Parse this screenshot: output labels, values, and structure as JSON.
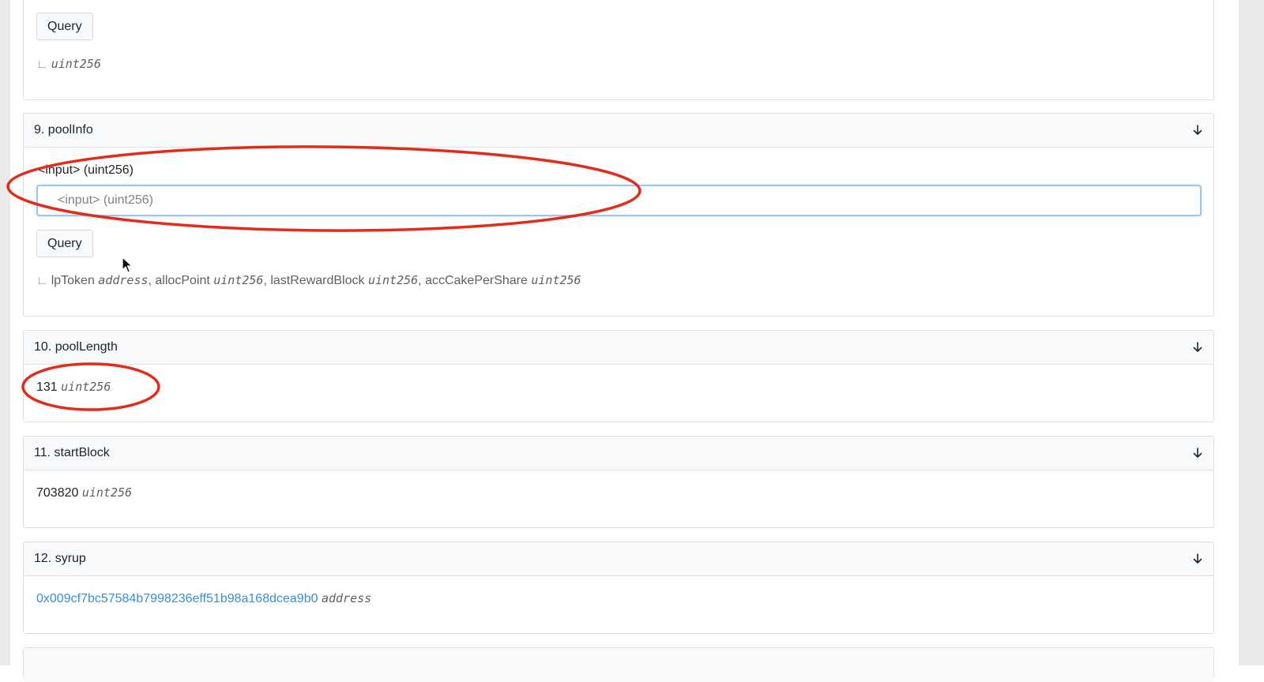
{
  "card8": {
    "query_label": "Query",
    "output_type": "uint256"
  },
  "card9": {
    "title": "9. poolInfo",
    "input_label": "<input> (uint256)",
    "input_placeholder": "<input> (uint256)",
    "query_label": "Query",
    "outputs": [
      {
        "name": "lpToken",
        "type": "address"
      },
      {
        "name": "allocPoint",
        "type": "uint256"
      },
      {
        "name": "lastRewardBlock",
        "type": "uint256"
      },
      {
        "name": "accCakePerShare",
        "type": "uint256"
      }
    ],
    "sep": ", "
  },
  "card10": {
    "title": "10. poolLength",
    "value": "131",
    "type": "uint256"
  },
  "card11": {
    "title": "11. startBlock",
    "value": "703820",
    "type": "uint256"
  },
  "card12": {
    "title": "12. syrup",
    "value": "0x009cf7bc57584b7998236eff51b98a168dcea9b0",
    "type": "address"
  },
  "colors": {
    "annotation_red": "#e32b17",
    "link_blue": "#3a8ed2",
    "focus_border": "#9ec5ec"
  },
  "icons": {
    "collapse": "arrow-down-icon",
    "corner": "corner-branch-icon",
    "cursor": "mouse-pointer-icon"
  }
}
